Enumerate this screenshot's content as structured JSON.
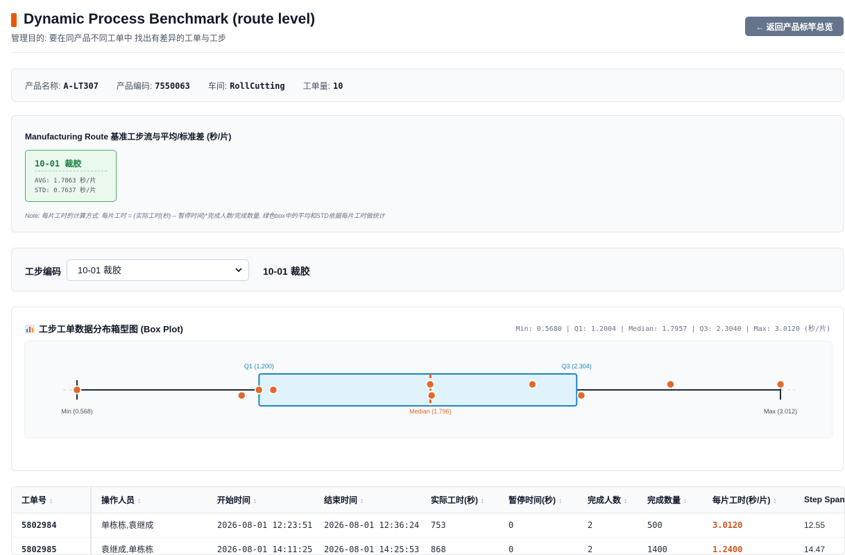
{
  "header": {
    "title": "Dynamic Process Benchmark (route level)",
    "subtitle": "管理目的: 要在同产品不同工单中 找出有差异的工单与工步",
    "back_button": "← 返回产品标竿总览"
  },
  "product_info": {
    "name_label": "产品名称:",
    "name_value": "A-LT307",
    "code_label": "产品编码:",
    "code_value": "7550063",
    "workshop_label": "车间:",
    "workshop_value": "RollCutting",
    "orders_label": "工单量:",
    "orders_value": "10"
  },
  "route": {
    "title": "Manufacturing Route 基准工步流与平均/标准差 (秒/片)",
    "step": {
      "name": "10-01 裁胶",
      "avg": "AVG: 1.7863 秒/片",
      "std": "STD: 0.7637 秒/片"
    },
    "note": "Note: 每片工时的计算方式: 每片工时 = (实际工时(秒) – 暂停时间)*完成人数/完成数量, 绿色box中的平均和STD依据每片工时做统计"
  },
  "selector": {
    "label": "工步编码",
    "selected": "10-01 裁胶",
    "chevron_icon": "chevron-down-icon",
    "display": "10-01 裁胶"
  },
  "boxplot": {
    "title": "工步工单数据分布箱型图 (Box Plot)",
    "icon": "bar-chart-icon",
    "stats": "Min: 0.5680 | Q1: 1.2004 | Median: 1.7957 | Q3: 2.3040 | Max: 3.0120 (秒/片)",
    "labels": {
      "q1": "Q1 (1.200)",
      "q3": "Q3 (2.304)",
      "median": "Median (1.796)",
      "min": "Min (0.568)",
      "max": "Max (3.012)"
    },
    "colors": {
      "box_fill": "#e0f2fc",
      "box_stroke": "#1a87c0",
      "median": "#e06a2c",
      "points": "#e06a2c",
      "whisker": "#1f2937"
    }
  },
  "chart_data": {
    "type": "boxplot",
    "title": "工步工单数据分布箱型图 (Box Plot)",
    "unit": "秒/片",
    "min": 0.568,
    "q1": 1.2004,
    "median": 1.7957,
    "q3": 2.304,
    "max": 3.012,
    "points": [
      0.568,
      1.14,
      1.2,
      1.25,
      1.795,
      1.8,
      2.15,
      2.32,
      2.63,
      3.012
    ]
  },
  "table": {
    "columns": [
      "工单号",
      "操作人员",
      "开始时间",
      "结束时间",
      "实际工时(秒)",
      "暂停时间(秒)",
      "完成人数",
      "完成数量",
      "每片工时(秒/片)",
      "Step Span T"
    ],
    "rows": [
      [
        "5802984",
        "单栋栋,袁继成",
        "2026-08-01 12:23:51",
        "2026-08-01 12:36:24",
        "753",
        "0",
        "2",
        "500",
        "3.0120",
        "12.55"
      ],
      [
        "5802985",
        "袁继成,单栋栋",
        "2026-08-01 14:11:25",
        "2026-08-01 14:25:53",
        "868",
        "0",
        "2",
        "1400",
        "1.2400",
        "14.47"
      ]
    ]
  }
}
